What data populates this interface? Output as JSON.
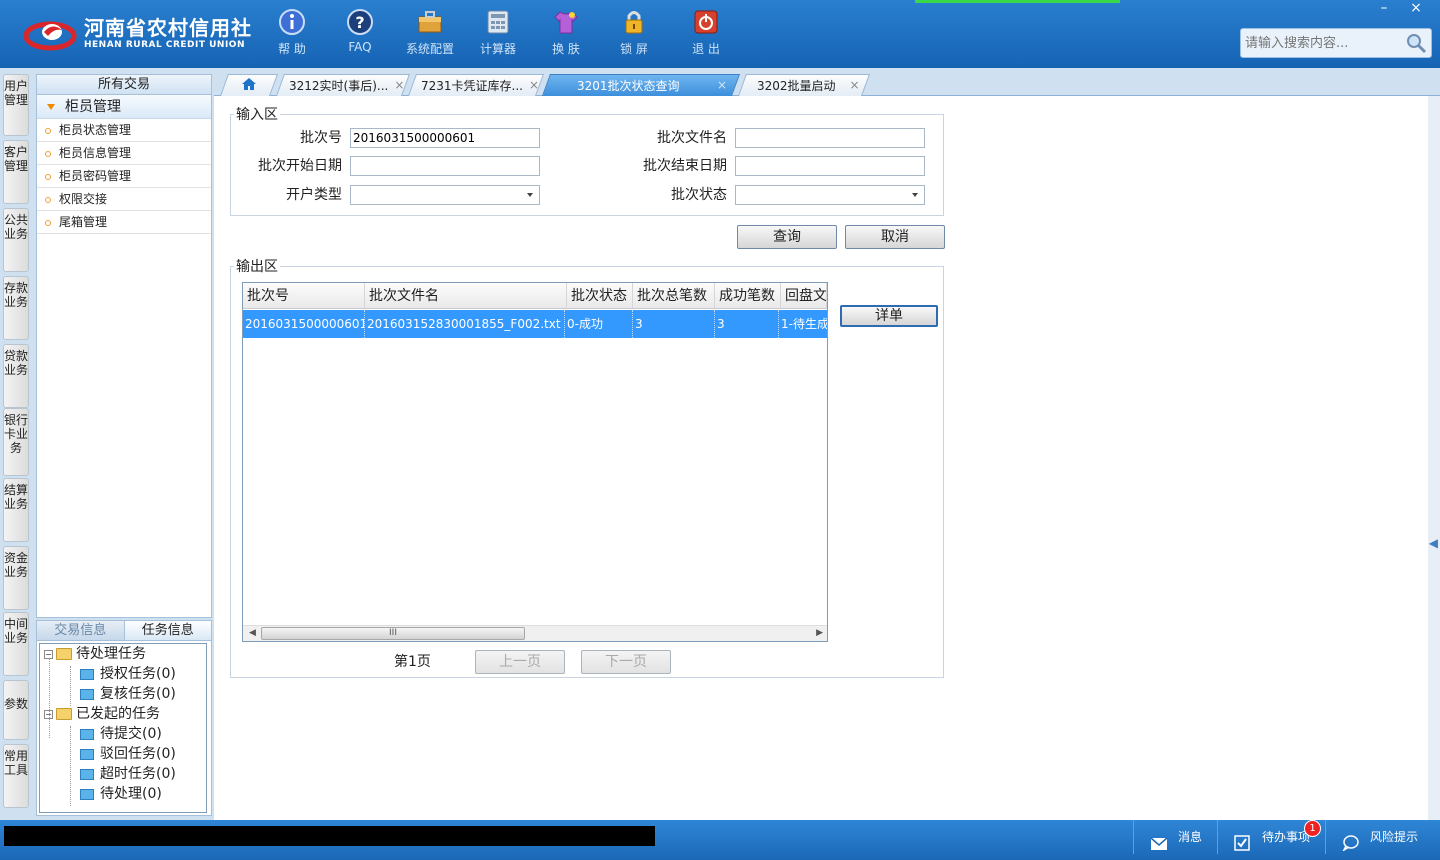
{
  "header": {
    "logo_cn": "河南省农村信用社",
    "logo_en": "HENAN RURAL CREDIT UNION",
    "toolbar": [
      {
        "icon": "info-icon",
        "label": "帮 助"
      },
      {
        "icon": "faq-icon",
        "label": "FAQ"
      },
      {
        "icon": "toolbox-icon",
        "label": "系统配置"
      },
      {
        "icon": "calculator-icon",
        "label": "计算器"
      },
      {
        "icon": "shirt-icon",
        "label": "换 肤"
      },
      {
        "icon": "lock-icon",
        "label": "锁 屏"
      },
      {
        "icon": "power-icon",
        "label": "退 出"
      }
    ],
    "search_placeholder": "请输入搜索内容...",
    "min_label": "–",
    "close_label": "×"
  },
  "vnav": [
    "用户管理",
    "客户管理",
    "公共业务",
    "存款业务",
    "贷款业务",
    "银行卡业务",
    "结算业务",
    "资金业务",
    "中间业务",
    "参数",
    "常用工具"
  ],
  "sidebar": {
    "all_label": "所有交易",
    "group": "柜员管理",
    "items": [
      "柜员状态管理",
      "柜员信息管理",
      "柜员密码管理",
      "权限交接",
      "尾箱管理"
    ],
    "bottom_tabs": [
      "交易信息",
      "任务信息"
    ],
    "tree": {
      "pending": "待处理任务",
      "pending_children": [
        "授权任务(0)",
        "复核任务(0)"
      ],
      "started": "已发起的任务",
      "started_children": [
        "待提交(0)",
        "驳回任务(0)",
        "超时任务(0)",
        "待处理(0)"
      ]
    }
  },
  "tabs": [
    {
      "label": "3212实时(事后)...",
      "close": "×"
    },
    {
      "label": "7231卡凭证库存...",
      "close": "×"
    },
    {
      "label": "3201批次状态查询",
      "close": "×"
    },
    {
      "label": "3202批量启动",
      "close": "×"
    }
  ],
  "input_area": {
    "legend": "输入区",
    "batch_no_label": "批次号",
    "batch_no_value": "2016031500000601",
    "batch_file_label": "批次文件名",
    "batch_file_value": "",
    "start_date_label": "批次开始日期",
    "start_date_value": "",
    "end_date_label": "批次结束日期",
    "end_date_value": "",
    "account_type_label": "开户类型",
    "account_type_value": "",
    "batch_status_label": "批次状态",
    "batch_status_value": ""
  },
  "buttons": {
    "query": "查询",
    "cancel": "取消",
    "detail": "详单",
    "prev": "上一页",
    "next": "下一页"
  },
  "output_area": {
    "legend": "输出区",
    "columns": [
      "批次号",
      "批次文件名",
      "批次状态",
      "批次总笔数",
      "成功笔数",
      "回盘文"
    ],
    "rows": [
      [
        "2016031500000601",
        "201603152830001855_F002.txt",
        "0-成功",
        "3",
        "3",
        "1-待生成"
      ]
    ],
    "page_label": "第1页",
    "scroll_grip": "III"
  },
  "status": {
    "message": "消息",
    "todo": "待办事项",
    "todo_count": "1",
    "risk": "风险提示"
  }
}
